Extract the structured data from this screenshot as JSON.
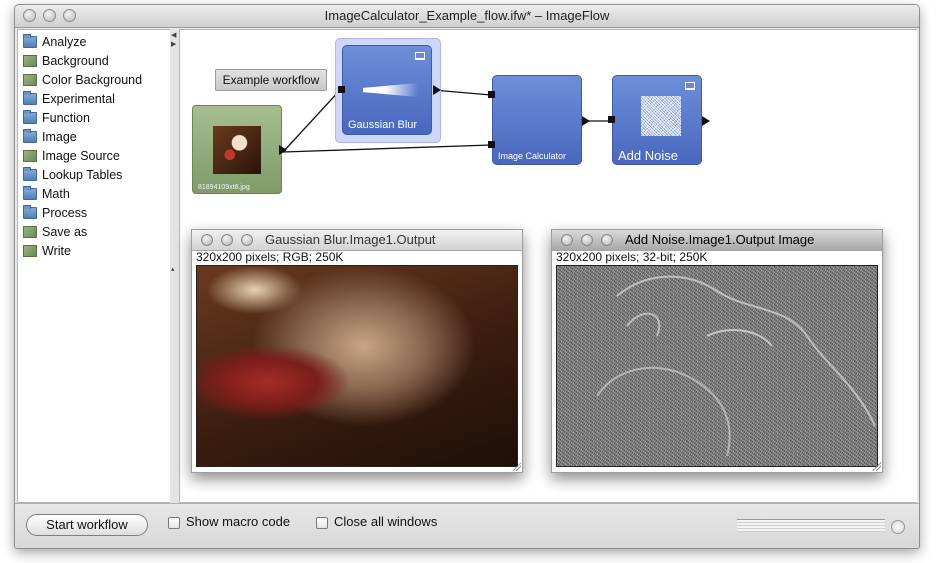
{
  "window": {
    "title": "ImageCalculator_Example_flow.ifw* – ImageFlow"
  },
  "sidebar": {
    "items": [
      {
        "label": "Analyze",
        "icon": "folder-icon"
      },
      {
        "label": "Background",
        "icon": "image-icon"
      },
      {
        "label": "Color Background",
        "icon": "image-icon"
      },
      {
        "label": "Experimental",
        "icon": "folder-icon"
      },
      {
        "label": "Function",
        "icon": "folder-icon"
      },
      {
        "label": "Image",
        "icon": "folder-icon"
      },
      {
        "label": "Image Source",
        "icon": "image-icon"
      },
      {
        "label": "Lookup Tables",
        "icon": "folder-icon"
      },
      {
        "label": "Math",
        "icon": "folder-icon"
      },
      {
        "label": "Process",
        "icon": "folder-icon"
      },
      {
        "label": "Save as",
        "icon": "image-icon"
      },
      {
        "label": "Write",
        "icon": "image-icon"
      }
    ]
  },
  "workflow": {
    "label": "Example workflow",
    "nodes": {
      "source": {
        "filename": "81894109xt8.jpg"
      },
      "gaussian_blur": {
        "label": "Gaussian Blur"
      },
      "image_calculator": {
        "label": "Image Calculator"
      },
      "add_noise": {
        "label": "Add Noise"
      }
    }
  },
  "output_windows": [
    {
      "title": "Gaussian Blur.Image1.Output",
      "info": "320x200 pixels; RGB; 250K"
    },
    {
      "title": "Add Noise.Image1.Output Image",
      "info": "320x200 pixels; 32-bit; 250K"
    }
  ],
  "bottom": {
    "start_button": "Start workflow",
    "show_macro_code": "Show macro code",
    "close_all_windows": "Close all windows"
  },
  "colors": {
    "node_blue": "#5577cc",
    "node_selected_border": "#a9b6ee",
    "source_node_green": "#8fab7a"
  }
}
